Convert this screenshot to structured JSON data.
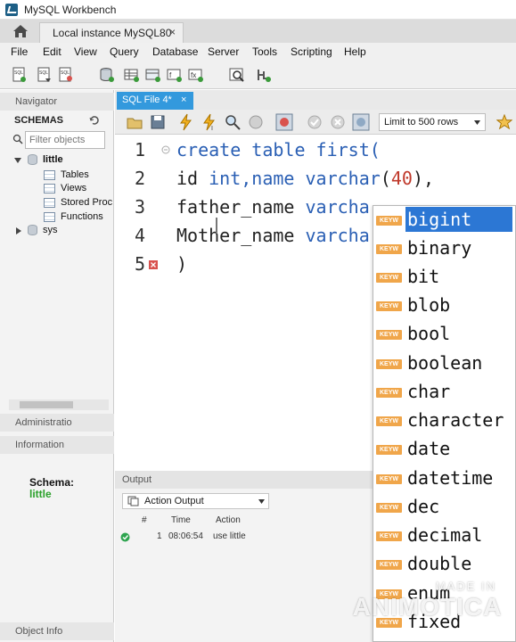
{
  "window": {
    "title": "MySQL Workbench"
  },
  "instance_tab": {
    "label": "Local instance MySQL80",
    "close": "×"
  },
  "menu": [
    "File",
    "Edit",
    "View",
    "Query",
    "Database",
    "Server",
    "Tools",
    "Scripting",
    "Help"
  ],
  "navigator": {
    "header": "Navigator",
    "schemas_label": "SCHEMAS",
    "filter_placeholder": "Filter objects",
    "tree": {
      "schema1": "little",
      "children": [
        "Tables",
        "Views",
        "Stored Proc",
        "Functions"
      ],
      "schema2": "sys"
    },
    "admin_tab": "Administratio",
    "info_header": "Information",
    "info_schema_label": "Schema:",
    "info_schema_value": "little",
    "object_info_tab": "Object Info",
    "colors": {
      "schema_value": "#2aa12a"
    }
  },
  "editor_tab": {
    "label": "SQL File 4*",
    "close": "×"
  },
  "sql_toolbar": {
    "limit_label": "Limit to 500 rows"
  },
  "editor": {
    "line_numbers": [
      "1",
      "2",
      "3",
      "4",
      "5"
    ],
    "lines": {
      "l1_kw": "create table",
      "l1_rest": " first(",
      "l2_a": "id ",
      "l2_b": "int",
      "l2_c": ",name ",
      "l2_d": "varchar",
      "l2_e": "(",
      "l2_f": "40",
      "l2_g": "),",
      "l3_a": "father_name ",
      "l3_b": "varcha",
      "l4_a": "Mother_name ",
      "l4_b": "varcha",
      "l5": ")"
    }
  },
  "output": {
    "header": "Output",
    "selector": "Action Output",
    "columns": {
      "num": "#",
      "time": "Time",
      "action": "Action"
    },
    "row": {
      "num": "1",
      "time": "08:06:54",
      "action": "use little"
    }
  },
  "autocomplete": {
    "badge": "KEYW",
    "items": [
      "bigint",
      "binary",
      "bit",
      "blob",
      "bool",
      "boolean",
      "char",
      "character",
      "date",
      "datetime",
      "dec",
      "decimal",
      "double",
      "enum",
      "fixed"
    ],
    "selected_item": "bigint",
    "colors": {
      "badge": "#f0a64a",
      "selected": "#2c77d4"
    }
  },
  "watermark": {
    "line1": "MADE IN",
    "line2": "ANIMOTICA"
  }
}
